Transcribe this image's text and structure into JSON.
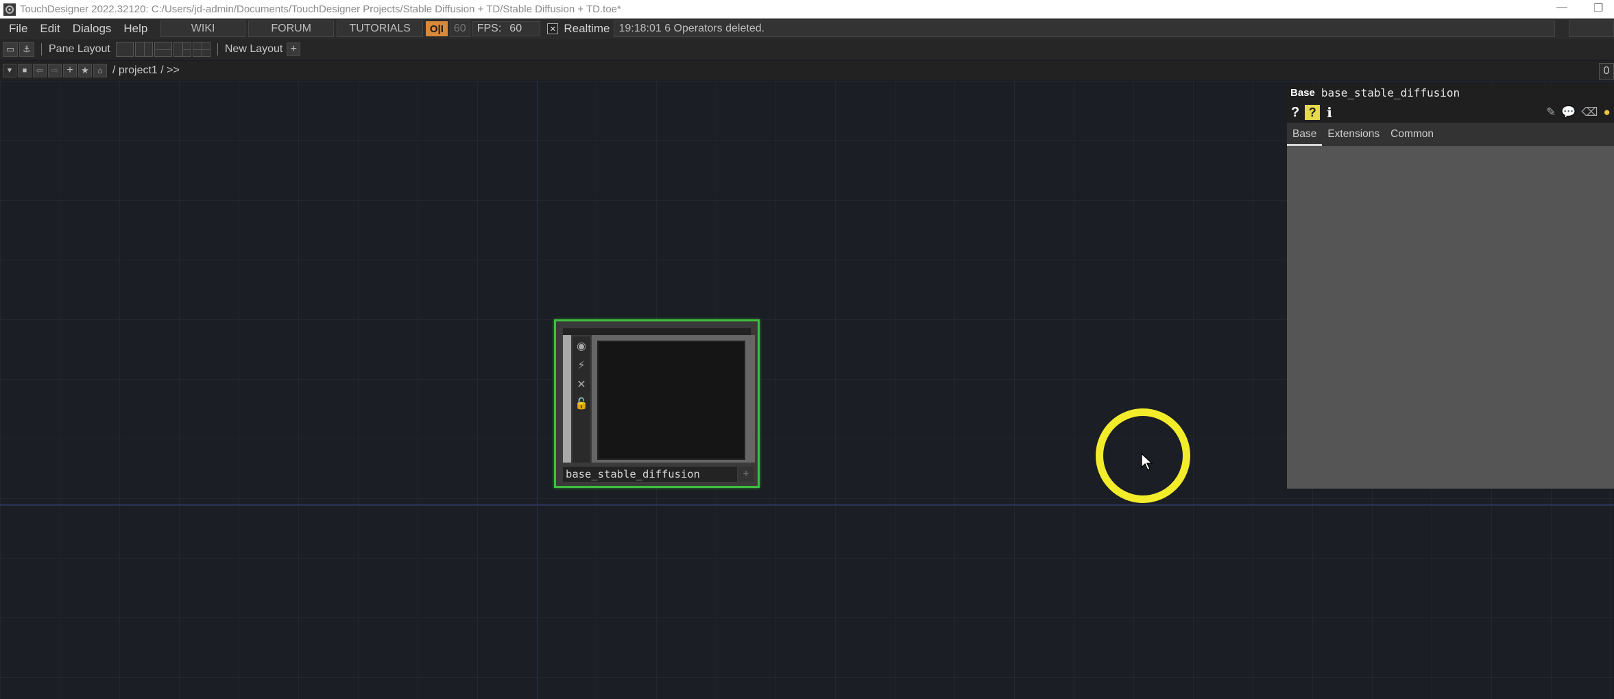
{
  "title_bar": {
    "title": "TouchDesigner 2022.32120: C:/Users/jd-admin/Documents/TouchDesigner Projects/Stable Diffusion + TD/Stable Diffusion + TD.toe*",
    "restore_glyph": "❐"
  },
  "menu": {
    "items": [
      "File",
      "Edit",
      "Dialogs",
      "Help"
    ],
    "links": [
      "WIKI",
      "FORUM",
      "TUTORIALS"
    ],
    "oi_label": "O|I",
    "count_value": "60",
    "fps_label": "FPS:",
    "fps_value": "60",
    "realtime_label": "Realtime",
    "realtime_checked": "✕",
    "status_message": "19:18:01 6 Operators deleted."
  },
  "layout_bar": {
    "pane_layout_label": "Pane Layout",
    "new_layout_label": "New Layout",
    "add_glyph": "+"
  },
  "path_bar": {
    "path": "/ project1 / >>",
    "right_value": "0"
  },
  "node": {
    "name": "base_stable_diffusion",
    "plus_glyph": "+"
  },
  "param_panel": {
    "op_type": "Base",
    "op_name": "base_stable_diffusion",
    "help_glyph": "?",
    "info_glyph": "i",
    "tabs": [
      "Base",
      "Extensions",
      "Common"
    ],
    "active_tab": "Base"
  },
  "colors": {
    "accent_green": "#3fbf3f",
    "cursor_yellow": "#f3ec2b",
    "oi_orange": "#d8893a"
  }
}
